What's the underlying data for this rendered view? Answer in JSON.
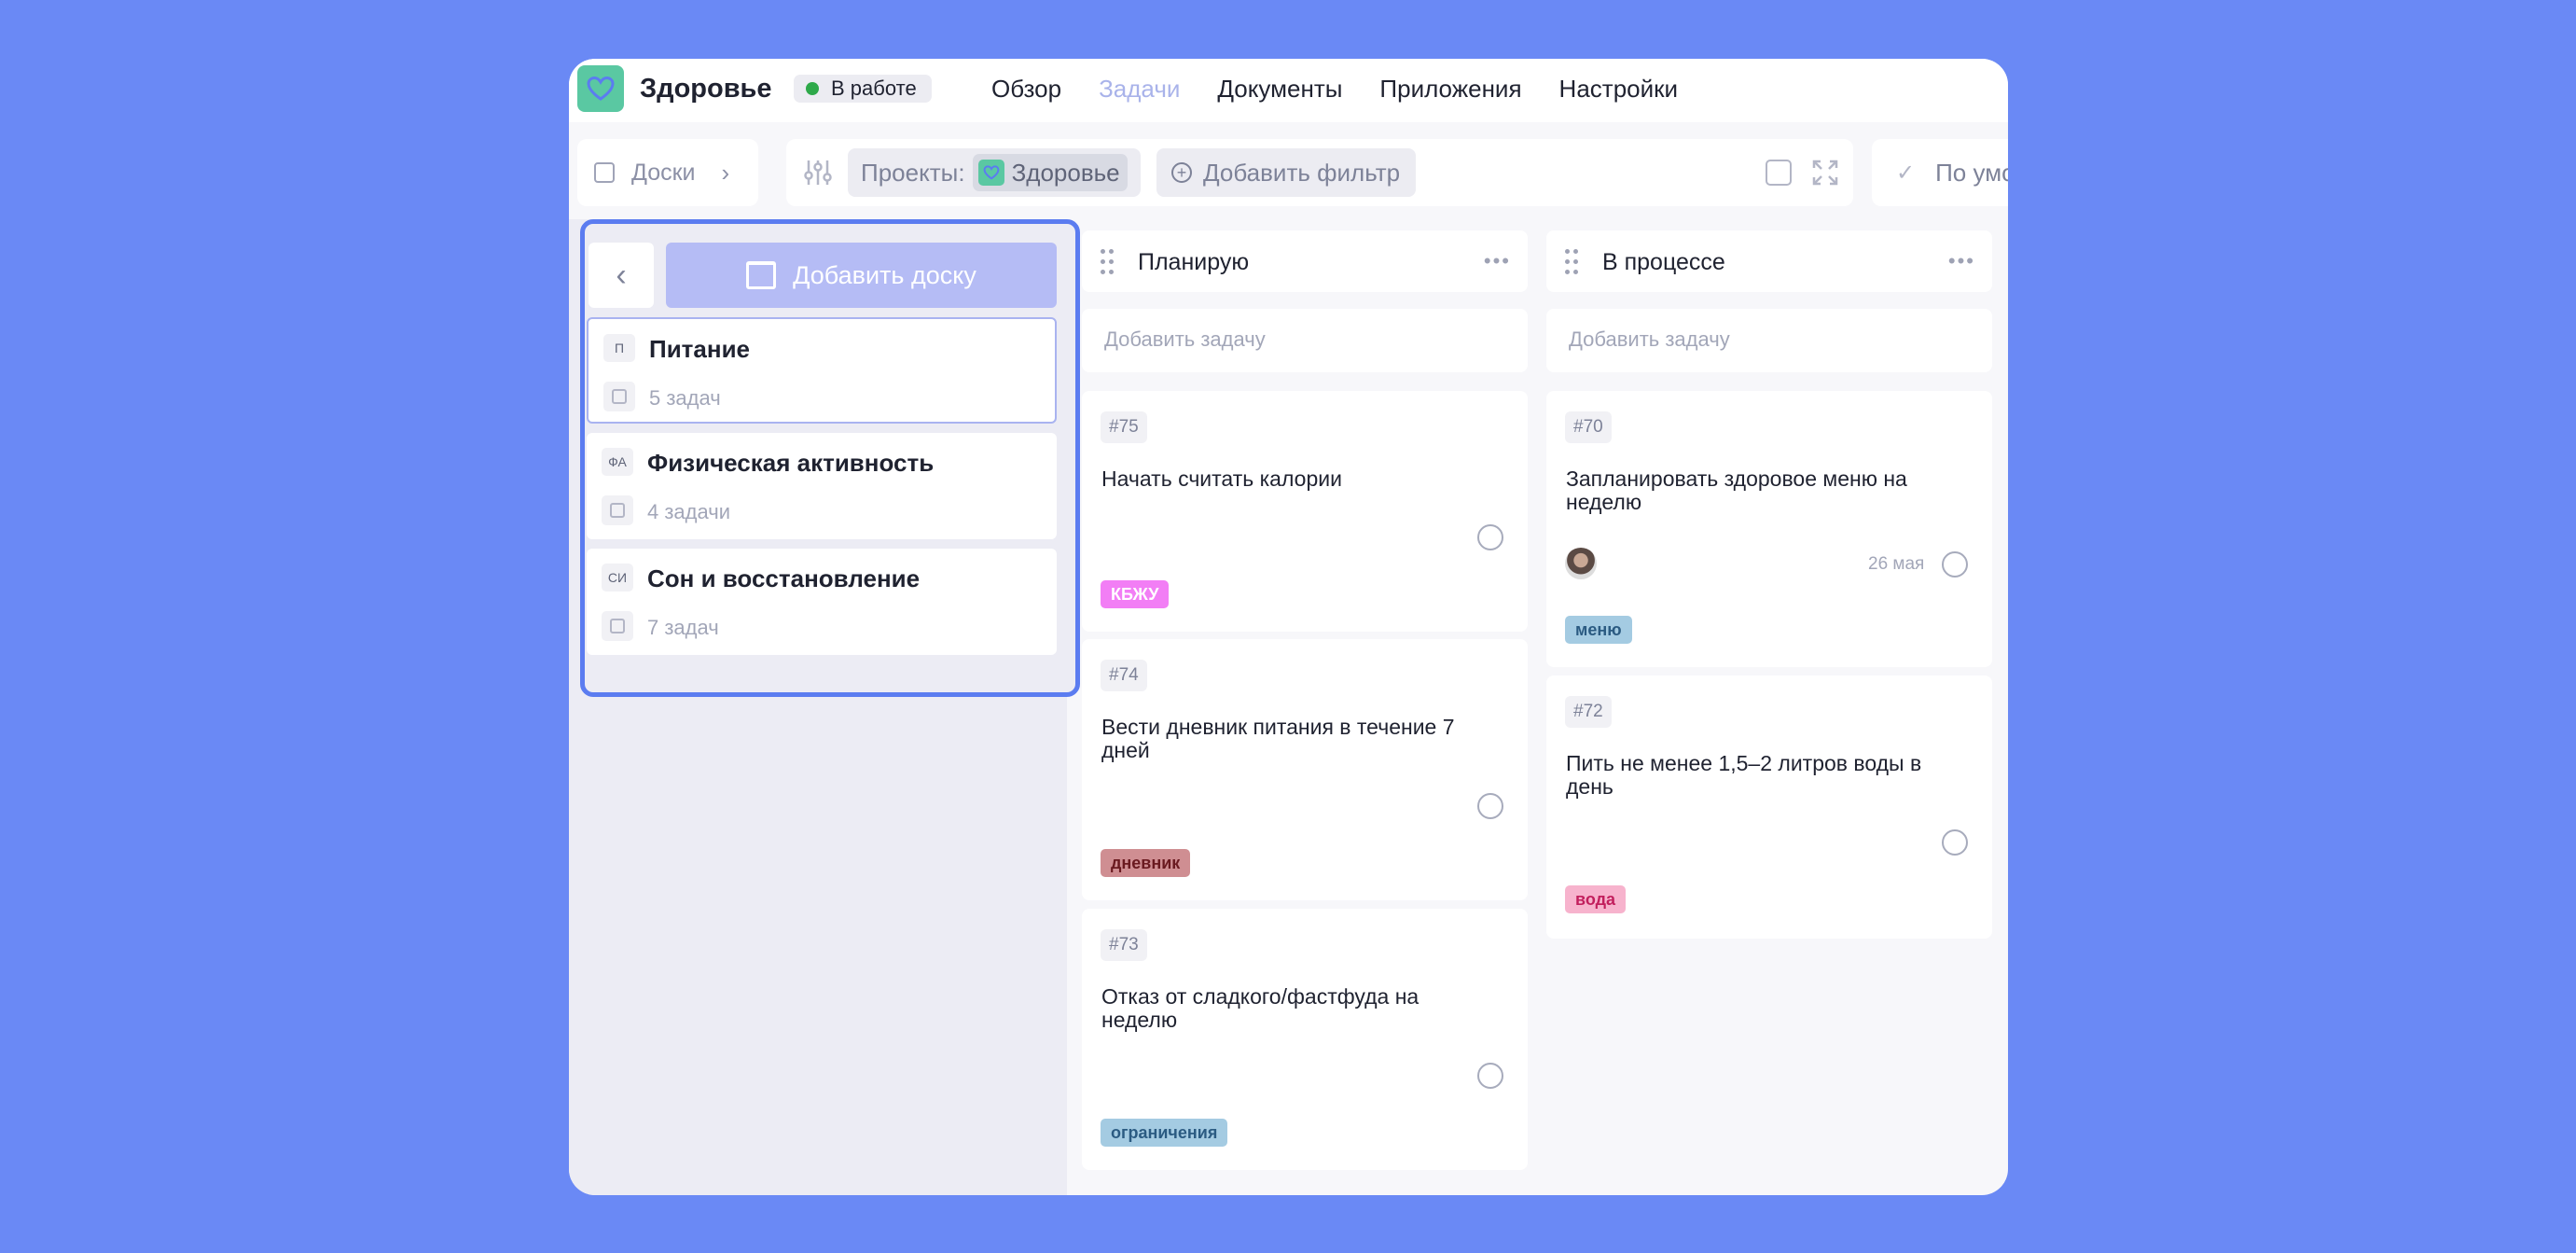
{
  "app": {
    "title": "Здоровье",
    "status": "В работе",
    "status_color": "#2ea94a",
    "accent": "#5b7cf0"
  },
  "nav": {
    "items": [
      "Обзор",
      "Задачи",
      "Документы",
      "Приложения",
      "Настройки"
    ],
    "active": "Задачи"
  },
  "toolbar": {
    "boards_label": "Доски",
    "projects_label": "Проекты:",
    "project_name": "Здоровье",
    "add_filter_label": "Добавить фильтр",
    "sort_label": "По умолчанию"
  },
  "boards_panel": {
    "add_board_label": "Добавить доску",
    "boards": [
      {
        "badge": "П",
        "name": "Питание",
        "count": "5 задач",
        "selected": true
      },
      {
        "badge": "ФА",
        "name": "Физическая активность",
        "count": "4 задачи",
        "selected": false
      },
      {
        "badge": "СИ",
        "name": "Сон и восстановление",
        "count": "7 задач",
        "selected": false
      }
    ]
  },
  "columns": [
    {
      "title": "Планирую",
      "add_task_label": "Добавить задачу",
      "tasks": [
        {
          "num": "#75",
          "title": "Начать считать калории",
          "label": "КБЖУ",
          "label_bg": "#f27ef5",
          "label_fg": "#ffffff"
        },
        {
          "num": "#74",
          "title": "Вести дневник питания в течение 7 дней",
          "label": "дневник",
          "label_bg": "#cf8e92",
          "label_fg": "#6a1a20"
        },
        {
          "num": "#73",
          "title": "Отказ от сладкого/фастфуда на неделю",
          "label": "ограничения",
          "label_bg": "#a4cbe2",
          "label_fg": "#2b5b82"
        }
      ]
    },
    {
      "title": "В процессе",
      "add_task_label": "Добавить задачу",
      "tasks": [
        {
          "num": "#70",
          "title": "Запланировать здоровое меню на неделю",
          "date": "26 мая",
          "label": "меню",
          "label_bg": "#a4cbe2",
          "label_fg": "#2b5b82"
        },
        {
          "num": "#72",
          "title": "Пить не менее 1,5–2 литров воды в день",
          "label": "вода",
          "label_bg": "#f7b3cd",
          "label_fg": "#c21f5d"
        }
      ]
    }
  ]
}
